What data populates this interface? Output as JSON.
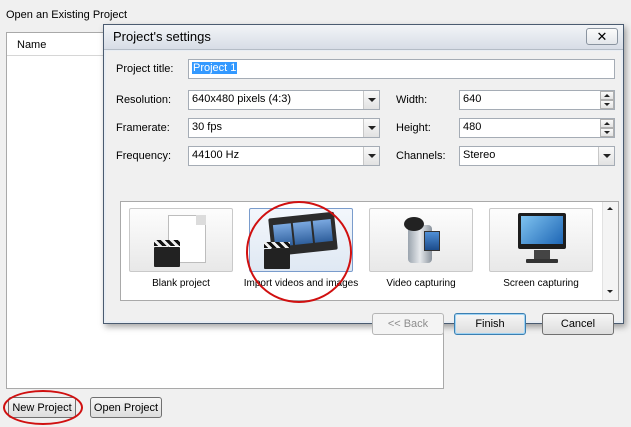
{
  "background_window": {
    "title": "Open an Existing Project",
    "list_header_name": "Name",
    "new_project_label": "New Project",
    "open_project_label": "Open Project"
  },
  "dialog": {
    "title": "Project's settings",
    "close_glyph": "✕",
    "project_title_label": "Project title:",
    "project_title_value": "Project 1",
    "resolution_label": "Resolution:",
    "resolution_value": "640x480 pixels (4:3)",
    "framerate_label": "Framerate:",
    "framerate_value": "30 fps",
    "frequency_label": "Frequency:",
    "frequency_value": "44100 Hz",
    "width_label": "Width:",
    "width_value": "640",
    "height_label": "Height:",
    "height_value": "480",
    "channels_label": "Channels:",
    "channels_value": "Stereo",
    "tiles": [
      {
        "label": "Blank project",
        "icon": "blank-project-icon"
      },
      {
        "label": "Import videos and images",
        "icon": "import-videos-icon"
      },
      {
        "label": "Video capturing",
        "icon": "video-camera-icon"
      },
      {
        "label": "Screen capturing",
        "icon": "screen-monitor-icon"
      }
    ],
    "selected_tile": 1,
    "back_label": "<< Back",
    "finish_label": "Finish",
    "cancel_label": "Cancel"
  },
  "colors": {
    "highlight_circle": "#d01010",
    "selection": "#3399ff",
    "tile_selected_border": "#7a9ccc"
  }
}
